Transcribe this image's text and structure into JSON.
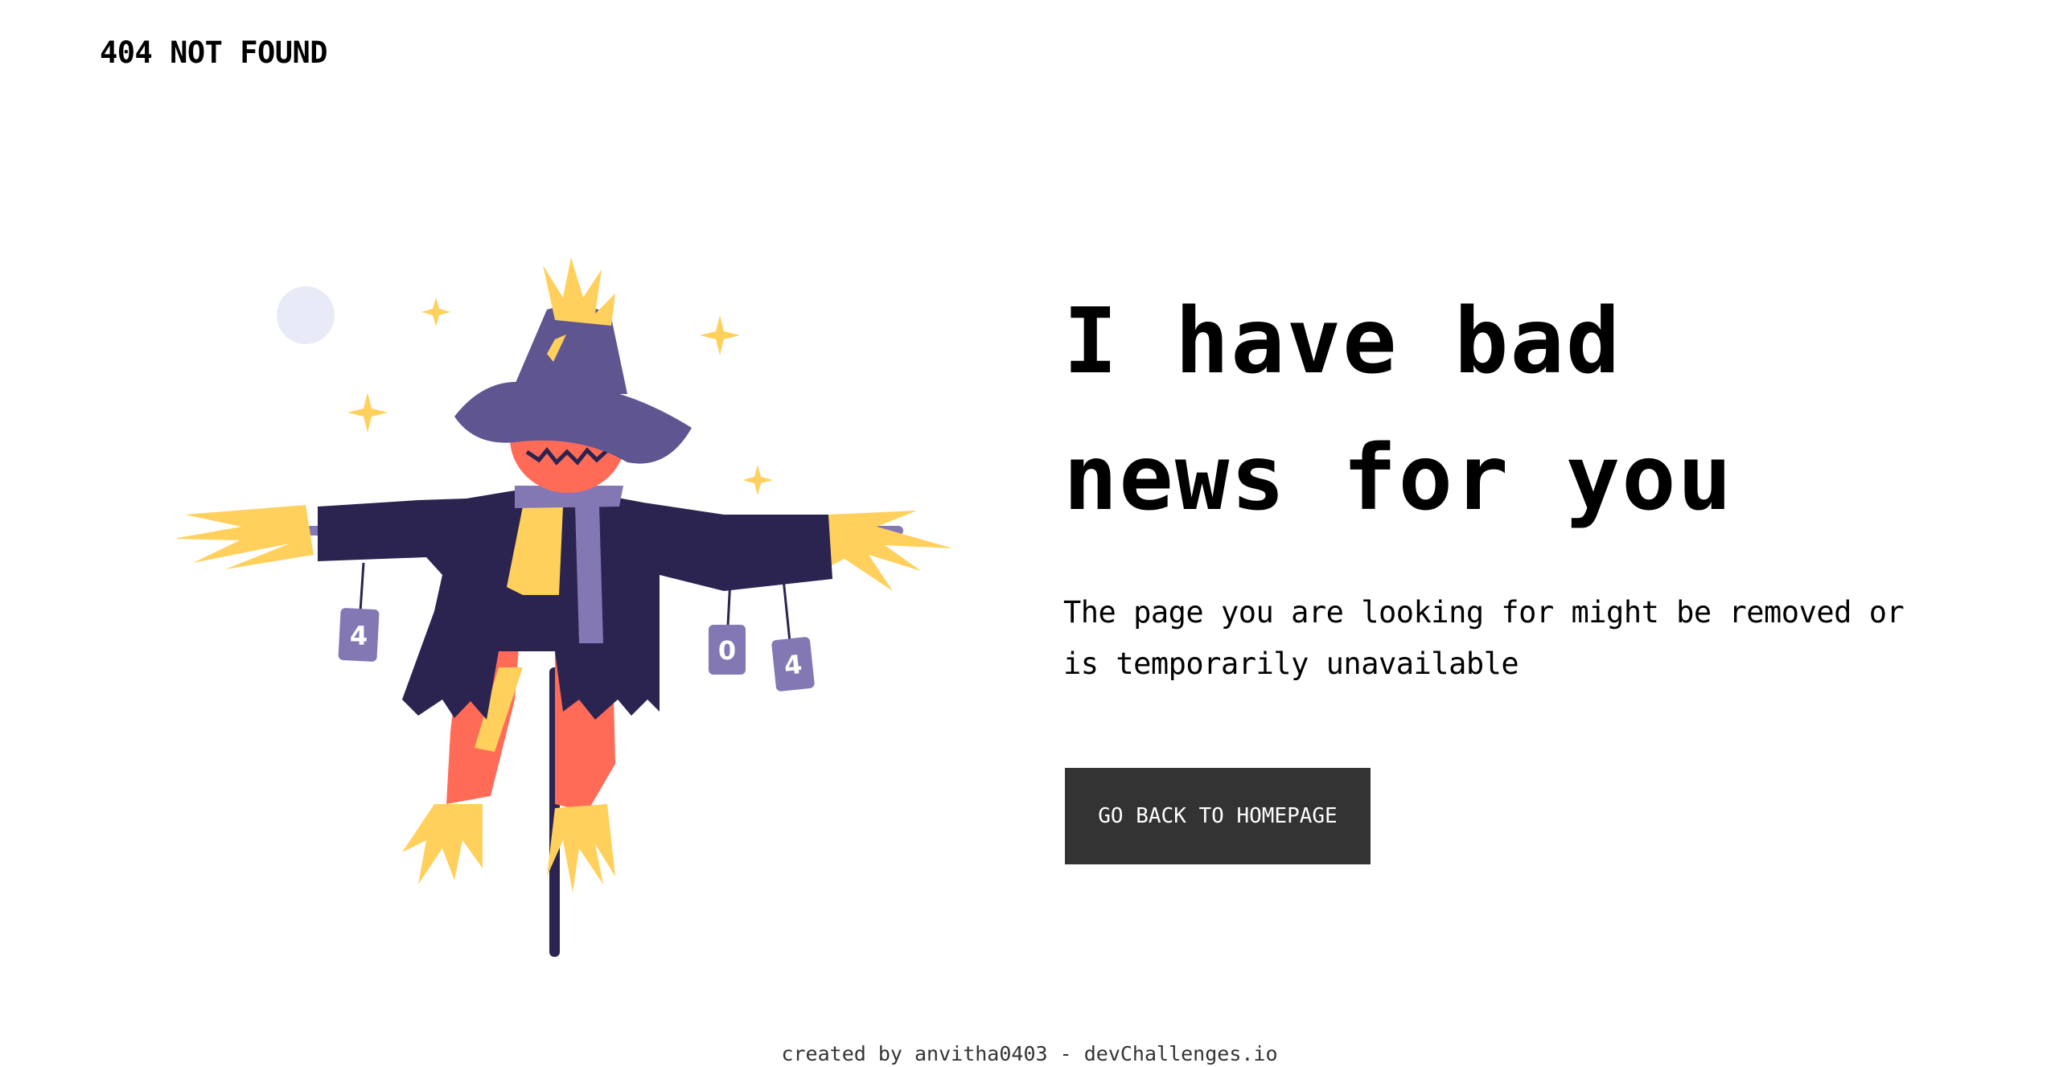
{
  "header": {
    "brand": "404 NOT FOUND"
  },
  "illustration": {
    "name": "scarecrow-illustration",
    "cans": [
      "4",
      "0",
      "4"
    ]
  },
  "main": {
    "headline_line1": "I have bad",
    "headline_line2": "news for you",
    "description": "The page you are looking for might be removed or is temporarily unavailable",
    "button_label": "GO BACK TO HOMEPAGE"
  },
  "footer": {
    "credit": "created by anvitha0403 - devChallenges.io"
  },
  "colors": {
    "button_bg": "#333333",
    "button_text": "#ffffff",
    "hat": "#5F5591",
    "coat": "#2B2450",
    "pumpkin": "#FF6B57",
    "straw": "#FFD15C",
    "moon": "#E8EBF7",
    "can": "#8478B4"
  }
}
